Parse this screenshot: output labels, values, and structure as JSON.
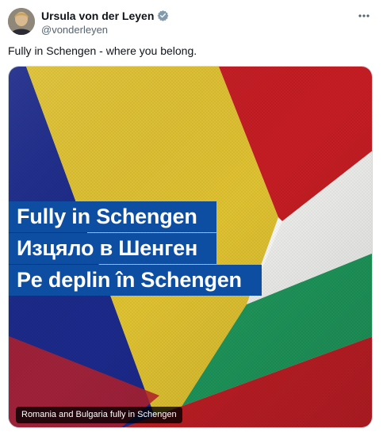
{
  "author": {
    "name": "Ursula von der Leyen",
    "handle": "@vonderleyen",
    "verified_icon": "verified-badge-icon",
    "avatar_icon": "avatar"
  },
  "menu_icon": "more-options-icon",
  "tweet": {
    "text": "Fully in Schengen - where you belong."
  },
  "media": {
    "headline_lines": [
      "Fully in Schengen",
      "Изцяло в Шенген",
      "Pe deplin în Schengen"
    ],
    "caption": "Romania and Bulgaria fully in Schengen"
  },
  "colors": {
    "banner": "#0d4ea3",
    "romania_blue": "#1c2a8c",
    "romania_yellow": "#e3c532",
    "romania_red": "#c81e24",
    "bulgaria_white": "#f3f3f1",
    "bulgaria_green": "#1f9a5d",
    "bulgaria_red": "#c11f25",
    "verified": "#829aab"
  }
}
